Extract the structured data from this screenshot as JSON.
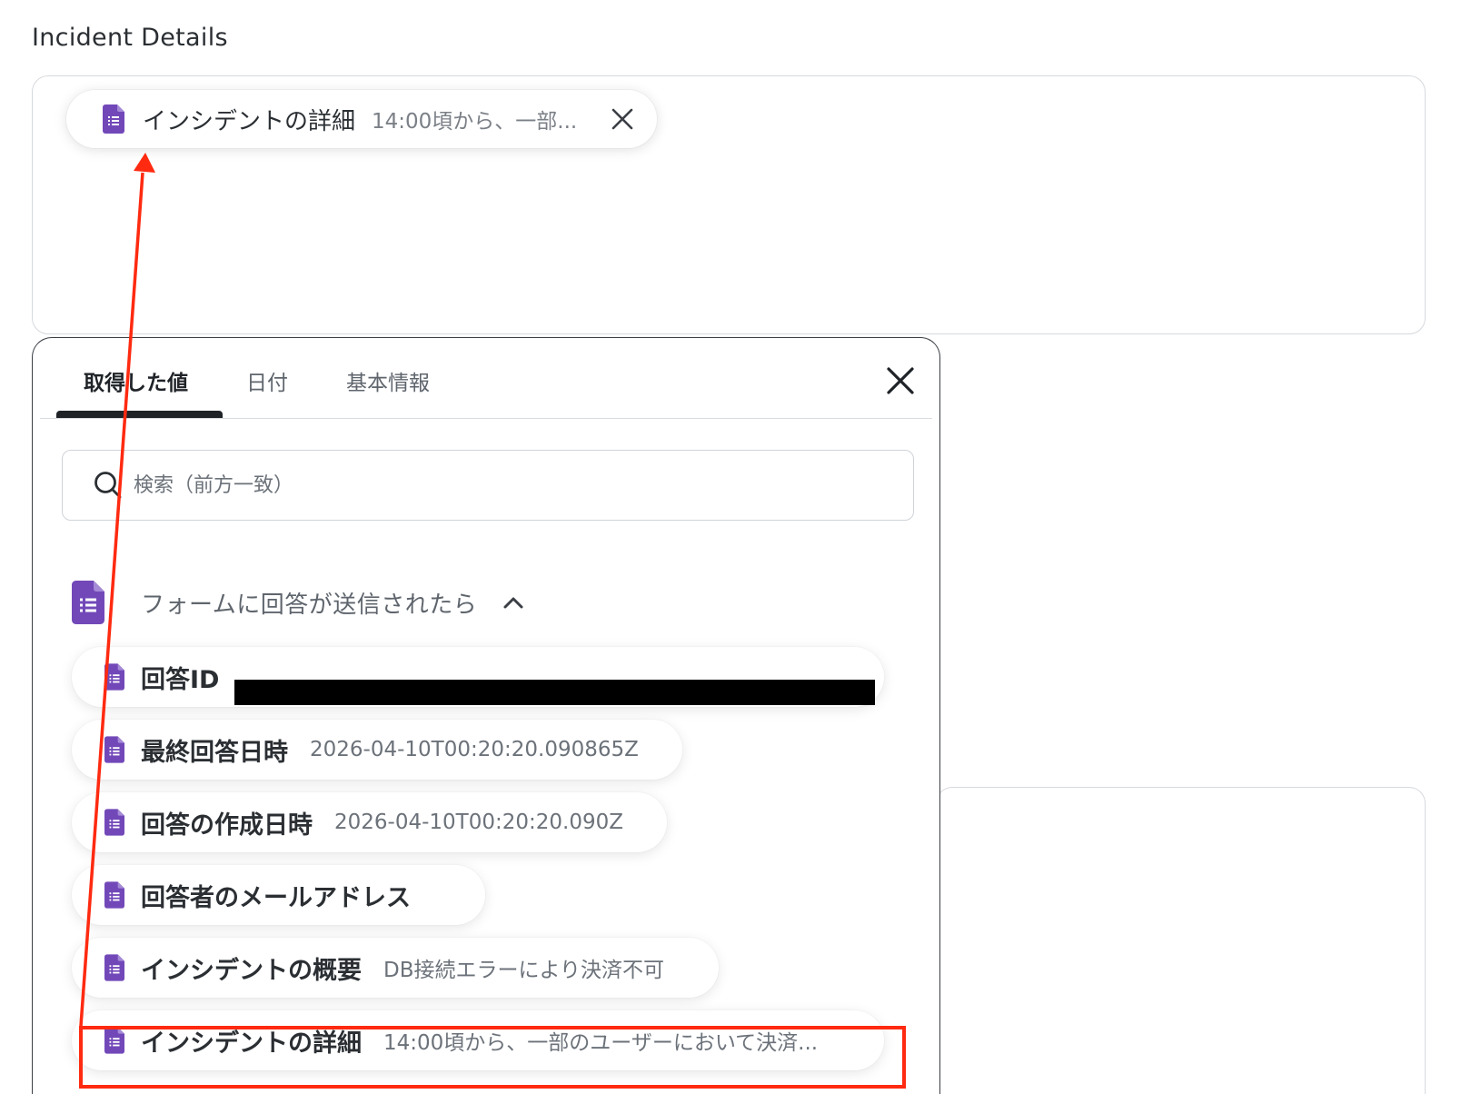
{
  "field": {
    "label": "Incident Details",
    "token": {
      "label": "インシデントの詳細",
      "value": "14:00頃から、一部..."
    }
  },
  "popup": {
    "tabs": [
      {
        "label": "取得した値"
      },
      {
        "label": "日付"
      },
      {
        "label": "基本情報"
      }
    ],
    "search": {
      "placeholder": "検索（前方一致）"
    },
    "group": {
      "title": "フォームに回答が送信されたら"
    },
    "items": [
      {
        "label": "回答ID",
        "value": ""
      },
      {
        "label": "最終回答日時",
        "value": "2026-04-10T00:20:20.090865Z"
      },
      {
        "label": "回答の作成日時",
        "value": "2026-04-10T00:20:20.090Z"
      },
      {
        "label": "回答者のメールアドレス",
        "value": ""
      },
      {
        "label": "インシデントの概要",
        "value": "DB接続エラーにより決済不可"
      },
      {
        "label": "インシデントの詳細",
        "value": "14:00頃から、一部のユーザーにおいて決済..."
      }
    ]
  },
  "colors": {
    "form_icon": "#7248b9",
    "annotation": "#ff2a10",
    "active_tab_underline": "#1f2328"
  },
  "icons": {
    "form": "google-forms-icon",
    "close": "close-icon",
    "search": "search-icon",
    "chevron": "chevron-up-icon"
  }
}
